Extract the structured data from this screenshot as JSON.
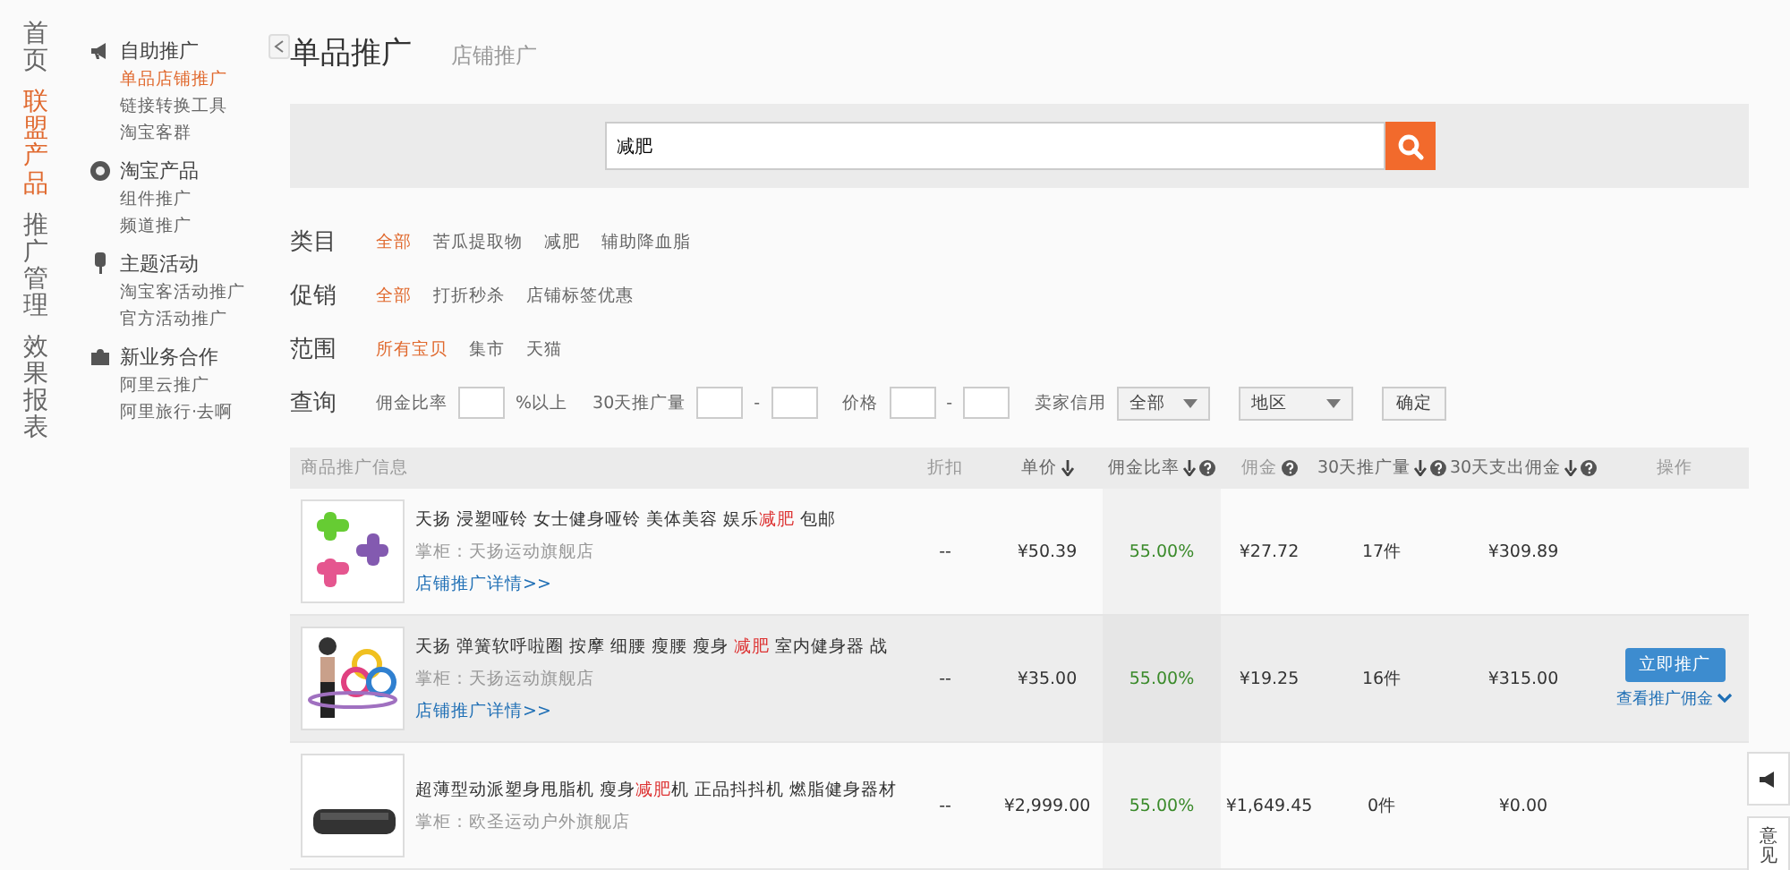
{
  "nav": [
    {
      "label": "首页",
      "selected": false
    },
    {
      "label": "联盟产品",
      "selected": true
    },
    {
      "label": "推广管理",
      "selected": false
    },
    {
      "label": "效果报表",
      "selected": false
    }
  ],
  "submenu": [
    {
      "title": "自助推广",
      "items": [
        {
          "label": "单品店铺推广",
          "selected": true
        },
        {
          "label": "链接转换工具",
          "selected": false
        },
        {
          "label": "淘宝客群",
          "selected": false
        }
      ]
    },
    {
      "title": "淘宝产品",
      "items": [
        {
          "label": "组件推广",
          "selected": false
        },
        {
          "label": "频道推广",
          "selected": false
        }
      ]
    },
    {
      "title": "主题活动",
      "items": [
        {
          "label": "淘宝客活动推广",
          "selected": false
        },
        {
          "label": "官方活动推广",
          "selected": false
        }
      ]
    },
    {
      "title": "新业务合作",
      "items": [
        {
          "label": "阿里云推广",
          "selected": false
        },
        {
          "label": "阿里旅行·去啊",
          "selected": false
        }
      ]
    }
  ],
  "tabs": [
    {
      "label": "单品推广",
      "selected": true
    },
    {
      "label": "店铺推广",
      "selected": false
    }
  ],
  "search": {
    "value": "减肥"
  },
  "filters": [
    {
      "label": "类目",
      "options": [
        {
          "label": "全部",
          "selected": true
        },
        {
          "label": "苦瓜提取物",
          "selected": false
        },
        {
          "label": "减肥",
          "selected": false
        },
        {
          "label": "辅助降血脂",
          "selected": false
        }
      ]
    },
    {
      "label": "促销",
      "options": [
        {
          "label": "全部",
          "selected": true
        },
        {
          "label": "打折秒杀",
          "selected": false
        },
        {
          "label": "店铺标签优惠",
          "selected": false
        }
      ]
    },
    {
      "label": "范围",
      "options": [
        {
          "label": "所有宝贝",
          "selected": true
        },
        {
          "label": "集市",
          "selected": false
        },
        {
          "label": "天猫",
          "selected": false
        }
      ]
    }
  ],
  "query": {
    "label": "查询",
    "rate_label": "佣金比率",
    "rate_suffix": "%以上",
    "volume_label": "30天推广量",
    "price_label": "价格",
    "dash": "-",
    "credit_label": "卖家信用",
    "credit_value": "全部",
    "region_value": "地区",
    "confirm": "确定"
  },
  "table": {
    "columns": [
      {
        "label": "商品推广信息",
        "sort": false,
        "help": false
      },
      {
        "label": "折扣",
        "sort": false,
        "help": false
      },
      {
        "label": "单价",
        "sort": true,
        "help": false
      },
      {
        "label": "佣金比率",
        "sort": true,
        "help": true
      },
      {
        "label": "佣金",
        "sort": false,
        "help": true
      },
      {
        "label": "30天推广量",
        "sort": true,
        "help": true
      },
      {
        "label": "30天支出佣金",
        "sort": true,
        "help": true
      },
      {
        "label": "操作",
        "sort": false,
        "help": false
      }
    ],
    "rows": [
      {
        "title": [
          {
            "text": "天扬 浸塑哑铃 女士健身哑铃 美体美容 娱乐",
            "highlighted": false
          },
          {
            "text": "减肥",
            "highlighted": true
          },
          {
            "text": " 包邮",
            "highlighted": false
          }
        ],
        "shop": "掌柜：天扬运动旗舰店",
        "link": "店铺推广详情>>",
        "discount": "--",
        "price": "¥50.39",
        "rate": "55.00%",
        "commission": "¥27.72",
        "volume": "17件",
        "spend": "¥309.89",
        "hovered": false
      },
      {
        "title": [
          {
            "text": "天扬 弹簧软呼啦圈 按摩 细腰 瘦腰 瘦身 ",
            "highlighted": false
          },
          {
            "text": "减肥",
            "highlighted": true
          },
          {
            "text": " 室内健身器 战",
            "highlighted": false
          }
        ],
        "shop": "掌柜：天扬运动旗舰店",
        "link": "店铺推广详情>>",
        "discount": "--",
        "price": "¥35.00",
        "rate": "55.00%",
        "commission": "¥19.25",
        "volume": "16件",
        "spend": "¥315.00",
        "hovered": true,
        "action": "立即推广",
        "action_link": "查看推广佣金"
      },
      {
        "title": [
          {
            "text": "超薄型动派塑身甩脂机 瘦身",
            "highlighted": false
          },
          {
            "text": "减肥",
            "highlighted": true
          },
          {
            "text": "机 正品抖抖机 燃脂健身器材",
            "highlighted": false
          }
        ],
        "shop": "掌柜：欧圣运动户外旗舰店",
        "discount": "--",
        "price": "¥2,999.00",
        "rate": "55.00%",
        "commission": "¥1,649.45",
        "volume": "0件",
        "spend": "¥0.00",
        "hovered": false
      }
    ]
  },
  "side_tabs": {
    "feedback": "意见"
  }
}
